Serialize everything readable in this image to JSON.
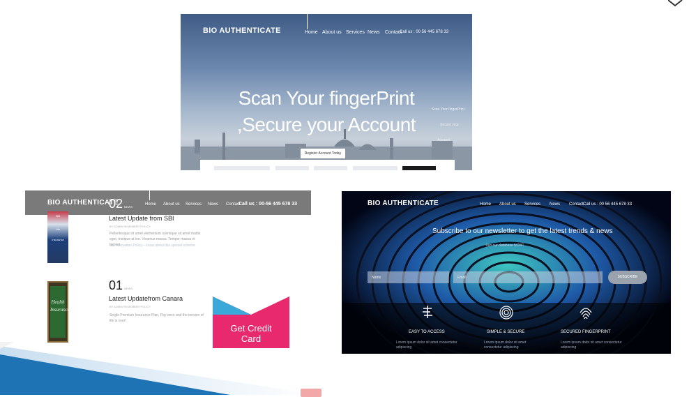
{
  "shared": {
    "brand": "BIO AUTHENTICATE"
  },
  "hero": {
    "title": "Scan Your fingerPrint ,Secure your Account",
    "nav": [
      "Home",
      "About us",
      "Services",
      "News",
      "Contact"
    ],
    "contact": "Call us : 00 56 445 678 33",
    "side_lines": [
      "Scan Your fingerPrint",
      "Secure your",
      "Account"
    ],
    "search_tab": "Register Account Today"
  },
  "news": {
    "nav": [
      "Home",
      "About us",
      "Services",
      "News",
      "Contact"
    ],
    "contact": "Call us : 00-56 445 678 33",
    "items": [
      {
        "num": "02",
        "suffix": "NEWS",
        "title": "Latest Update from SBI",
        "meta": "BY ADMIN  REMEMBER POLICY",
        "body": "Pellentesque sit amet elementum scerisque sit amet mattis eget, tristique at leo. Vivamus massa. Tempor massa et laoreet.",
        "link": "SBI Kanyadan Policy – know about this special scheme"
      },
      {
        "num": "01",
        "suffix": "NEWS",
        "title": "Latest Updatefrom Canara",
        "meta": "BY ADMIN  REMEMBER POLICY",
        "body": "Single Premium Insurance Plan, Pay once and the tension of life is over!",
        "link": ""
      }
    ],
    "thumb1_lines": [
      "SBI",
      "Life",
      "Insurance"
    ],
    "thumb2_lines": [
      "Health",
      "Insurance"
    ],
    "promo": "Get Credit Card"
  },
  "newsletter": {
    "nav": [
      "Home",
      "About us",
      "Services",
      "News",
      "Contact"
    ],
    "contact": "Call us : 00 56 445 678 33",
    "heading": "Subscribe to our newsletter to get the latest trends & news",
    "subheading": "Join our database NOW!",
    "name_placeholder": "Name",
    "email_placeholder": "Email",
    "button": "SUBSCRIBE",
    "features": [
      {
        "title": "EASY TO ACCESS",
        "text": "Lorem ipsum dolor sit amet consectetur adipiscing"
      },
      {
        "title": "SIMPLE & SECURE",
        "text": "Lorem ipsum dolor sit amet consectetur adipiscing"
      },
      {
        "title": "SECURED FINGERPRINT",
        "text": "Lorem ipsum dolor sit amet consectetur adipiscing"
      }
    ]
  },
  "colors": {
    "pink": "#e8296e",
    "teal": "#3aa8d8",
    "slide_blue": "#1e73b4"
  }
}
